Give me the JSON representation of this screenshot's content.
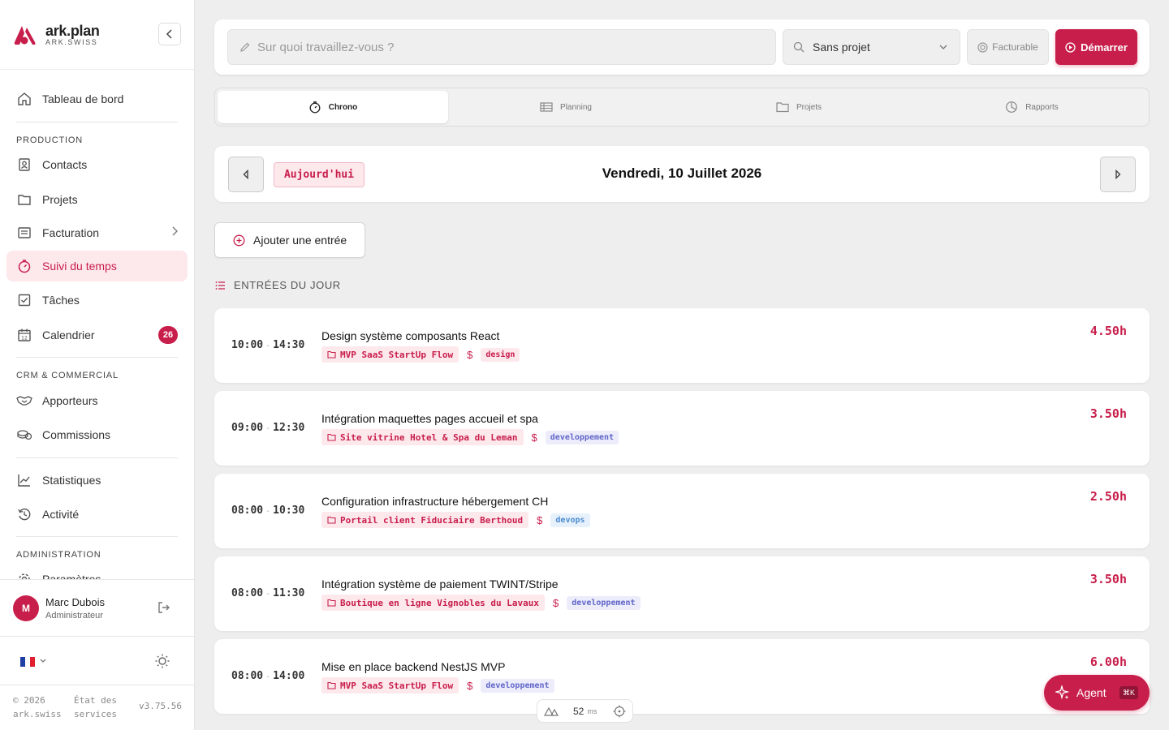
{
  "app": {
    "name": "ark.plan",
    "subtitle": "ARK.SWISS",
    "accent": "#c81e4b"
  },
  "sidebar": {
    "dashboard": "Tableau de bord",
    "sections": {
      "production": "PRODUCTION",
      "crm": "CRM & COMMERCIAL",
      "admin": "ADMINISTRATION"
    },
    "items": {
      "contacts": "Contacts",
      "projects": "Projets",
      "billing": "Facturation",
      "time_tracking": "Suivi du temps",
      "tasks": "Tâches",
      "calendar": "Calendrier",
      "calendar_badge": "26",
      "referrers": "Apporteurs",
      "commissions": "Commissions",
      "statistics": "Statistiques",
      "activity": "Activité",
      "settings": "Paramètres"
    },
    "user": {
      "initial": "M",
      "name": "Marc Dubois",
      "role": "Administrateur"
    },
    "footer": {
      "copyright_line1": "© 2026",
      "copyright_line2": "ark.swiss",
      "status_line1": "État des",
      "status_line2": "services",
      "version": "v3.75.56"
    }
  },
  "topbar": {
    "task_placeholder": "Sur quoi travaillez-vous ?",
    "project_select": "Sans projet",
    "billable_label": "Facturable",
    "start_label": "Démarrer"
  },
  "tabs": [
    {
      "label": "Chrono",
      "active": true
    },
    {
      "label": "Planning",
      "active": false
    },
    {
      "label": "Projets",
      "active": false
    },
    {
      "label": "Rapports",
      "active": false
    }
  ],
  "datebar": {
    "today_label": "Aujourd'hui",
    "date_title": "Vendredi, 10 Juillet 2026"
  },
  "add_entry_label": "Ajouter une entrée",
  "entries_title": "ENTRÉES DU JOUR",
  "entries": [
    {
      "start": "10:00",
      "end": "14:30",
      "description": "Design système composants React",
      "project": "MVP SaaS StartUp Flow",
      "category": "design",
      "duration": "4.50h"
    },
    {
      "start": "09:00",
      "end": "12:30",
      "description": "Intégration maquettes pages accueil et spa",
      "project": "Site vitrine Hotel & Spa du Leman",
      "category": "developpement",
      "duration": "3.50h"
    },
    {
      "start": "08:00",
      "end": "10:30",
      "description": "Configuration infrastructure hébergement CH",
      "project": "Portail client Fiduciaire Berthoud",
      "category": "devops",
      "duration": "2.50h"
    },
    {
      "start": "08:00",
      "end": "11:30",
      "description": "Intégration système de paiement TWINT/Stripe",
      "project": "Boutique en ligne Vignobles du Lavaux",
      "category": "developpement",
      "duration": "3.50h"
    },
    {
      "start": "08:00",
      "end": "14:00",
      "description": "Mise en place backend NestJS MVP",
      "project": "MVP SaaS StartUp Flow",
      "category": "developpement",
      "duration": "6.00h"
    }
  ],
  "perf": {
    "value": "52",
    "unit": "ms"
  },
  "agent": {
    "label": "Agent",
    "shortcut": "⌘K"
  },
  "time_dash": "-",
  "dollar_sign": "$"
}
